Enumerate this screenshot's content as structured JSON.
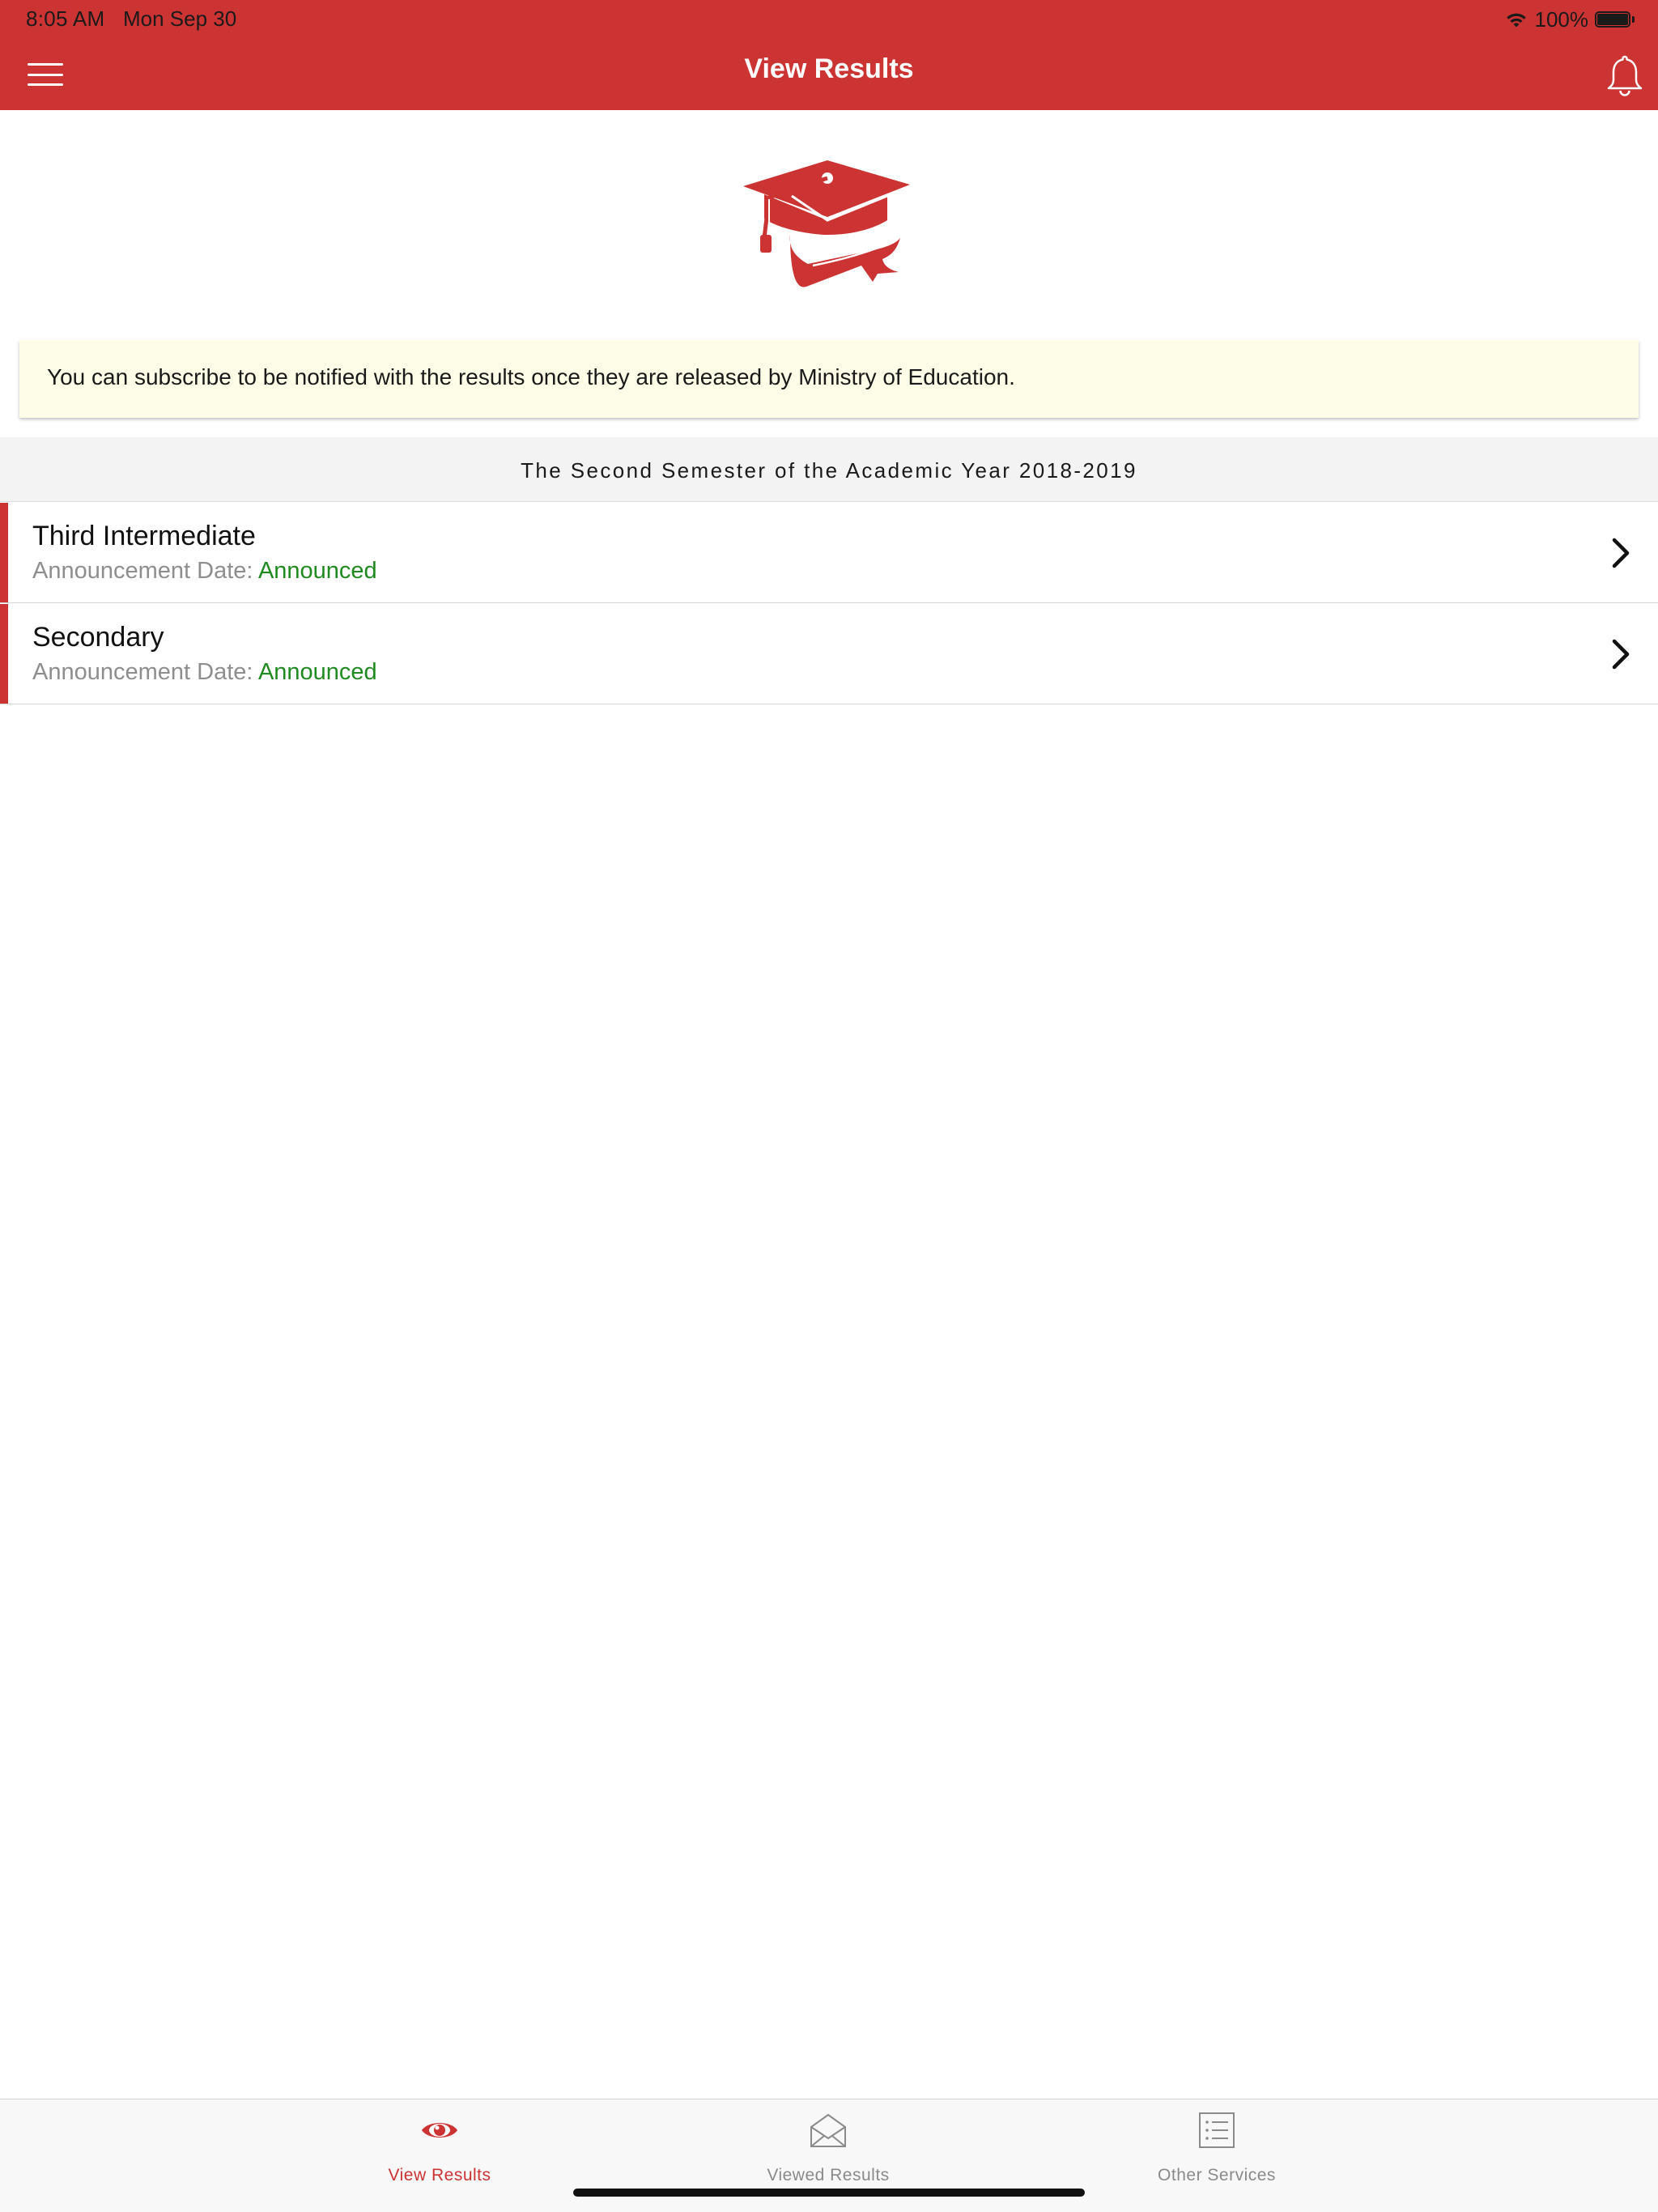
{
  "status_bar": {
    "time": "8:05 AM",
    "date": "Mon Sep 30",
    "battery_percent": "100%",
    "battery_level": 1.0
  },
  "nav": {
    "title": "View Results",
    "menu_icon": "hamburger-menu-icon",
    "bell_icon": "bell-icon"
  },
  "hero_icon": "graduation-cap-diploma-icon",
  "notice": {
    "text": "You can subscribe to be notified with the results once they are released by Ministry of Education."
  },
  "section": {
    "title": "The Second Semester of the Academic Year 2018-2019"
  },
  "results": [
    {
      "title": "Third Intermediate",
      "date_label": "Announcement Date:",
      "status": "Announced"
    },
    {
      "title": "Secondary",
      "date_label": "Announcement Date:",
      "status": "Announced"
    }
  ],
  "tabs": [
    {
      "label": "View Results",
      "icon": "eye-icon",
      "active": true
    },
    {
      "label": "Viewed Results",
      "icon": "open-envelope-icon",
      "active": false
    },
    {
      "label": "Other Services",
      "icon": "list-icon",
      "active": false
    }
  ],
  "colors": {
    "brand_red": "#cc3333",
    "announced_green": "#1f8a1f",
    "notice_bg": "#fefee8"
  }
}
